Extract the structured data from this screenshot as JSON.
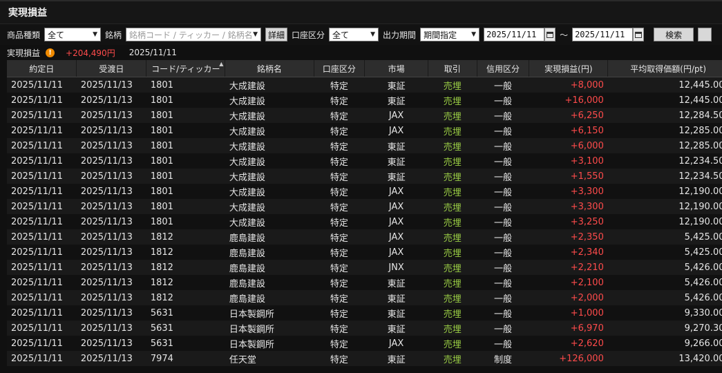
{
  "window": {
    "title": "実現損益"
  },
  "filters": {
    "product_type_label": "商品種類",
    "product_type_value": "全て",
    "symbol_label": "銘柄",
    "symbol_placeholder": "銘柄コード / ティッカー / 銘柄名",
    "detail_button": "詳細",
    "account_label": "口座区分",
    "account_value": "全て",
    "period_label": "出力期間",
    "period_value": "期間指定",
    "date_from": "2025/11/11",
    "tilde": "～",
    "date_to": "2025/11/11",
    "search_button": "検索"
  },
  "summary": {
    "label": "実現損益",
    "value": "+204,490円",
    "date": "2025/11/11"
  },
  "table": {
    "columns": [
      "約定日",
      "受渡日",
      "コード/ティッカー",
      "銘柄名",
      "口座区分",
      "市場",
      "取引",
      "信用区分",
      "実現損益(円)",
      "平均取得価額(円/pt)"
    ],
    "rows": [
      {
        "trade_date": "2025/11/11",
        "settle_date": "2025/11/13",
        "code": "1801",
        "name": "大成建設",
        "account": "特定",
        "market": "東証",
        "trade": "売埋",
        "credit": "一般",
        "pnl": "+8,000",
        "avg": "12,445.00"
      },
      {
        "trade_date": "2025/11/11",
        "settle_date": "2025/11/13",
        "code": "1801",
        "name": "大成建設",
        "account": "特定",
        "market": "東証",
        "trade": "売埋",
        "credit": "一般",
        "pnl": "+16,000",
        "avg": "12,445.00"
      },
      {
        "trade_date": "2025/11/11",
        "settle_date": "2025/11/13",
        "code": "1801",
        "name": "大成建設",
        "account": "特定",
        "market": "JAX",
        "trade": "売埋",
        "credit": "一般",
        "pnl": "+6,250",
        "avg": "12,284.50"
      },
      {
        "trade_date": "2025/11/11",
        "settle_date": "2025/11/13",
        "code": "1801",
        "name": "大成建設",
        "account": "特定",
        "market": "JAX",
        "trade": "売埋",
        "credit": "一般",
        "pnl": "+6,150",
        "avg": "12,285.00"
      },
      {
        "trade_date": "2025/11/11",
        "settle_date": "2025/11/13",
        "code": "1801",
        "name": "大成建設",
        "account": "特定",
        "market": "東証",
        "trade": "売埋",
        "credit": "一般",
        "pnl": "+6,000",
        "avg": "12,285.00"
      },
      {
        "trade_date": "2025/11/11",
        "settle_date": "2025/11/13",
        "code": "1801",
        "name": "大成建設",
        "account": "特定",
        "market": "東証",
        "trade": "売埋",
        "credit": "一般",
        "pnl": "+3,100",
        "avg": "12,234.50"
      },
      {
        "trade_date": "2025/11/11",
        "settle_date": "2025/11/13",
        "code": "1801",
        "name": "大成建設",
        "account": "特定",
        "market": "東証",
        "trade": "売埋",
        "credit": "一般",
        "pnl": "+1,550",
        "avg": "12,234.50"
      },
      {
        "trade_date": "2025/11/11",
        "settle_date": "2025/11/13",
        "code": "1801",
        "name": "大成建設",
        "account": "特定",
        "market": "JAX",
        "trade": "売埋",
        "credit": "一般",
        "pnl": "+3,300",
        "avg": "12,190.00"
      },
      {
        "trade_date": "2025/11/11",
        "settle_date": "2025/11/13",
        "code": "1801",
        "name": "大成建設",
        "account": "特定",
        "market": "JAX",
        "trade": "売埋",
        "credit": "一般",
        "pnl": "+3,300",
        "avg": "12,190.00"
      },
      {
        "trade_date": "2025/11/11",
        "settle_date": "2025/11/13",
        "code": "1801",
        "name": "大成建設",
        "account": "特定",
        "market": "JAX",
        "trade": "売埋",
        "credit": "一般",
        "pnl": "+3,250",
        "avg": "12,190.00"
      },
      {
        "trade_date": "2025/11/11",
        "settle_date": "2025/11/13",
        "code": "1812",
        "name": "鹿島建設",
        "account": "特定",
        "market": "JAX",
        "trade": "売埋",
        "credit": "一般",
        "pnl": "+2,350",
        "avg": "5,425.00"
      },
      {
        "trade_date": "2025/11/11",
        "settle_date": "2025/11/13",
        "code": "1812",
        "name": "鹿島建設",
        "account": "特定",
        "market": "JAX",
        "trade": "売埋",
        "credit": "一般",
        "pnl": "+2,340",
        "avg": "5,425.00"
      },
      {
        "trade_date": "2025/11/11",
        "settle_date": "2025/11/13",
        "code": "1812",
        "name": "鹿島建設",
        "account": "特定",
        "market": "JNX",
        "trade": "売埋",
        "credit": "一般",
        "pnl": "+2,210",
        "avg": "5,426.00"
      },
      {
        "trade_date": "2025/11/11",
        "settle_date": "2025/11/13",
        "code": "1812",
        "name": "鹿島建設",
        "account": "特定",
        "market": "東証",
        "trade": "売埋",
        "credit": "一般",
        "pnl": "+2,100",
        "avg": "5,426.00"
      },
      {
        "trade_date": "2025/11/11",
        "settle_date": "2025/11/13",
        "code": "1812",
        "name": "鹿島建設",
        "account": "特定",
        "market": "東証",
        "trade": "売埋",
        "credit": "一般",
        "pnl": "+2,000",
        "avg": "5,426.00"
      },
      {
        "trade_date": "2025/11/11",
        "settle_date": "2025/11/13",
        "code": "5631",
        "name": "日本製鋼所",
        "account": "特定",
        "market": "東証",
        "trade": "売埋",
        "credit": "一般",
        "pnl": "+1,000",
        "avg": "9,330.00"
      },
      {
        "trade_date": "2025/11/11",
        "settle_date": "2025/11/13",
        "code": "5631",
        "name": "日本製鋼所",
        "account": "特定",
        "market": "東証",
        "trade": "売埋",
        "credit": "一般",
        "pnl": "+6,970",
        "avg": "9,270.30"
      },
      {
        "trade_date": "2025/11/11",
        "settle_date": "2025/11/13",
        "code": "5631",
        "name": "日本製鋼所",
        "account": "特定",
        "market": "JAX",
        "trade": "売埋",
        "credit": "一般",
        "pnl": "+2,620",
        "avg": "9,266.00"
      },
      {
        "trade_date": "2025/11/11",
        "settle_date": "2025/11/13",
        "code": "7974",
        "name": "任天堂",
        "account": "特定",
        "market": "東証",
        "trade": "売埋",
        "credit": "制度",
        "pnl": "+126,000",
        "avg": "13,420.00"
      }
    ]
  },
  "colors": {
    "profit": "#ff4b4b",
    "sell": "#99cc44",
    "warning": "#f08a00"
  }
}
